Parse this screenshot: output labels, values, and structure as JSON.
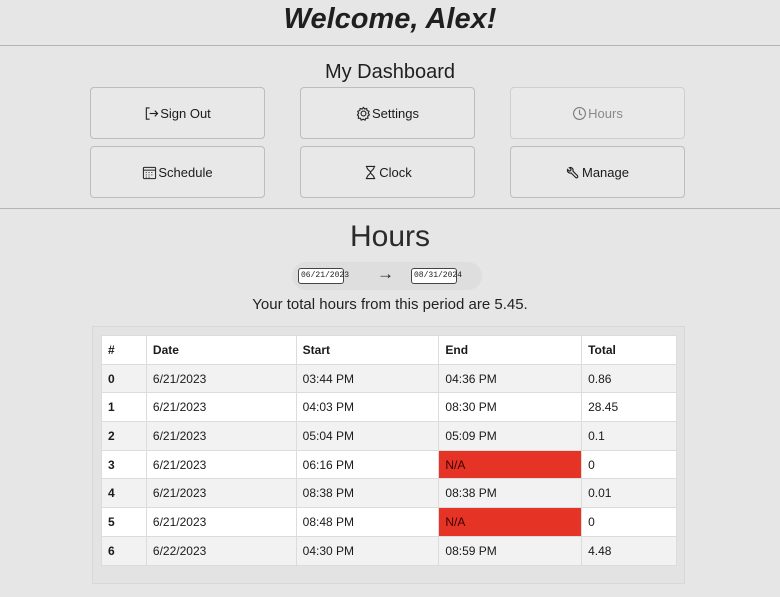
{
  "header": {
    "welcome": "Welcome, Alex!"
  },
  "dashboard": {
    "title": "My Dashboard",
    "buttons": [
      {
        "label": "Sign Out",
        "icon": "sign-out-icon",
        "enabled": true
      },
      {
        "label": "Settings",
        "icon": "gear-icon",
        "enabled": true
      },
      {
        "label": "Hours",
        "icon": "clock-icon",
        "enabled": false
      },
      {
        "label": "Schedule",
        "icon": "calendar-icon",
        "enabled": true
      },
      {
        "label": "Clock",
        "icon": "hourglass-icon",
        "enabled": true
      },
      {
        "label": "Manage",
        "icon": "wrench-icon",
        "enabled": true
      }
    ]
  },
  "hours": {
    "title": "Hours",
    "start_date": "06/21/2023",
    "arrow": "→",
    "end_date": "08/31/2024",
    "total_text": "Your total hours from this period are 5.45."
  },
  "table": {
    "headers": [
      "#",
      "Date",
      "Start",
      "End",
      "Total"
    ],
    "rows": [
      [
        "0",
        "6/21/2023",
        "03:44 PM",
        "04:36 PM",
        "0.86"
      ],
      [
        "1",
        "6/21/2023",
        "04:03 PM",
        "08:30 PM",
        "28.45"
      ],
      [
        "2",
        "6/21/2023",
        "05:04 PM",
        "05:09 PM",
        "0.1"
      ],
      [
        "3",
        "6/21/2023",
        "06:16 PM",
        "N/A",
        "0"
      ],
      [
        "4",
        "6/21/2023",
        "08:38 PM",
        "08:38 PM",
        "0.01"
      ],
      [
        "5",
        "6/21/2023",
        "08:48 PM",
        "N/A",
        "0"
      ],
      [
        "6",
        "6/22/2023",
        "04:30 PM",
        "08:59 PM",
        "4.48"
      ]
    ],
    "na_color": "#e53326"
  },
  "colors": {
    "background": "#e6e6e6",
    "missing_end": "#e53326"
  }
}
